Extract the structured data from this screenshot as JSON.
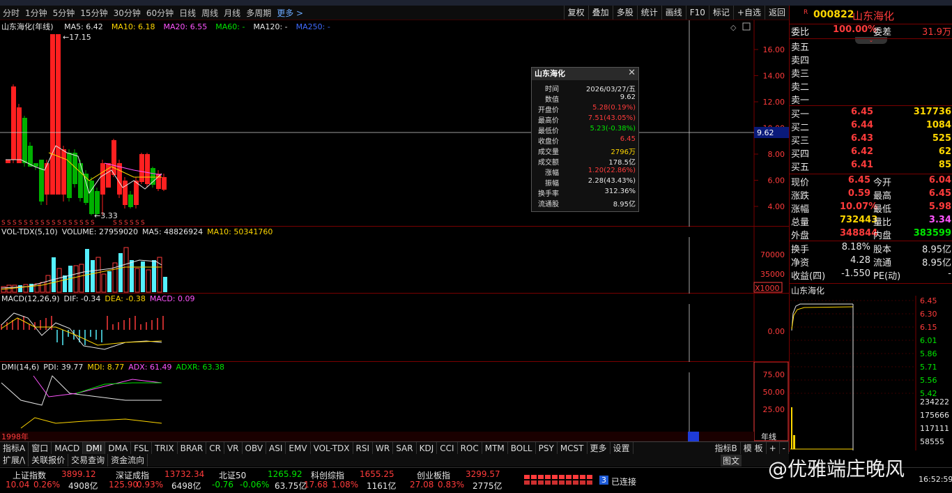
{
  "period_tabs": [
    "分时",
    "1分钟",
    "5分钟",
    "15分钟",
    "30分钟",
    "60分钟",
    "日线",
    "周线",
    "月线",
    "多周期"
  ],
  "period_more": "更多 >",
  "tool_buttons": [
    "复权",
    "叠加",
    "多股",
    "统计",
    "画线",
    "F10",
    "标记",
    "+自选",
    "返回"
  ],
  "main_chart": {
    "name": "山东海化(年线)",
    "ma": [
      {
        "label": "MA5: 6.42",
        "color": "#e8e8e8"
      },
      {
        "label": "MA10: 6.18",
        "color": "#ffd700"
      },
      {
        "label": "MA20: 6.55",
        "color": "#ff55ff"
      },
      {
        "label": "MA60: -",
        "color": "#00e600"
      },
      {
        "label": "MA120: -",
        "color": "#e8e8e8"
      },
      {
        "label": "MA250: -",
        "color": "#3f6bff"
      }
    ],
    "high_label": "17.15",
    "low_label": "3.33",
    "cursor_value": "9.62",
    "y_ticks": [
      "16.00",
      "14.00",
      "12.00",
      "10.00",
      "8.00",
      "6.00",
      "4.00"
    ],
    "start_label": "1998年"
  },
  "tooltip": {
    "title": "山东海化",
    "rows": [
      {
        "k": "时间",
        "v": "2026/03/27/五",
        "c": "#e8e8e8"
      },
      {
        "k": "数值",
        "v": "9.62",
        "c": "#e8e8e8"
      },
      {
        "k": "开盘价",
        "v": "5.28(0.19%)",
        "c": "#ff3b3b"
      },
      {
        "k": "最高价",
        "v": "7.51(43.05%)",
        "c": "#ff3b3b"
      },
      {
        "k": "最低价",
        "v": "5.23(-0.38%)",
        "c": "#00e600"
      },
      {
        "k": "收盘价",
        "v": "6.45",
        "c": "#ff3b3b"
      },
      {
        "k": "成交量",
        "v": "2796万",
        "c": "#ffd700"
      },
      {
        "k": "成交额",
        "v": "178.5亿",
        "c": "#e8e8e8"
      },
      {
        "k": "涨幅",
        "v": "1.20(22.86%)",
        "c": "#ff3b3b"
      },
      {
        "k": "振幅",
        "v": "2.28(43.43%)",
        "c": "#e8e8e8"
      },
      {
        "k": "换手率",
        "v": "312.36%",
        "c": "#e8e8e8"
      },
      {
        "k": "流通股",
        "v": "8.95亿",
        "c": "#e8e8e8"
      }
    ]
  },
  "vol_panel": {
    "header": [
      {
        "t": "VOL-TDX(5,10)",
        "c": "#e8e8e8"
      },
      {
        "t": "VOLUME: 27959020",
        "c": "#e8e8e8"
      },
      {
        "t": "MA5: 48826924",
        "c": "#e8e8e8"
      },
      {
        "t": "MA10: 50341760",
        "c": "#ffd700"
      }
    ],
    "y_ticks": [
      "70000",
      "35000"
    ],
    "unit": "X1000"
  },
  "macd_panel": {
    "header": [
      {
        "t": "MACD(12,26,9)",
        "c": "#e8e8e8"
      },
      {
        "t": "DIF: -0.34",
        "c": "#e8e8e8"
      },
      {
        "t": "DEA: -0.38",
        "c": "#ffd700"
      },
      {
        "t": "MACD: 0.09",
        "c": "#ff55ff"
      }
    ],
    "y_ticks": [
      "0.00"
    ]
  },
  "dmi_panel": {
    "header": [
      {
        "t": "DMI(14,6)",
        "c": "#e8e8e8"
      },
      {
        "t": "PDI: 39.77",
        "c": "#e8e8e8"
      },
      {
        "t": "MDI: 8.77",
        "c": "#ffd700"
      },
      {
        "t": "ADX: 61.49",
        "c": "#ff55ff"
      },
      {
        "t": "ADXR: 63.38",
        "c": "#00e600"
      }
    ],
    "y_ticks": [
      "75.00",
      "50.00",
      "25.00"
    ],
    "period_label": "年线"
  },
  "stock": {
    "badge": "R",
    "code": "000822",
    "name": "山东海化",
    "weibi_label": "委比",
    "weibi": "100.00%",
    "weicha_label": "委差",
    "weicha": "31.9万",
    "sells": [
      "卖五",
      "卖四",
      "卖三",
      "卖二",
      "卖一"
    ],
    "buys": [
      {
        "k": "买一",
        "p": "6.45",
        "v": "317736"
      },
      {
        "k": "买二",
        "p": "6.44",
        "v": "1084"
      },
      {
        "k": "买三",
        "p": "6.43",
        "v": "525"
      },
      {
        "k": "买四",
        "p": "6.42",
        "v": "62"
      },
      {
        "k": "买五",
        "p": "6.41",
        "v": "85"
      }
    ],
    "quote_rows": [
      {
        "k1": "现价",
        "v1": "6.45",
        "c1": "#ff3b3b",
        "k2": "今开",
        "v2": "6.04",
        "c2": "#ff3b3b"
      },
      {
        "k1": "涨跌",
        "v1": "0.59",
        "c1": "#ff3b3b",
        "k2": "最高",
        "v2": "6.45",
        "c2": "#ff3b3b"
      },
      {
        "k1": "涨幅",
        "v1": "10.07%",
        "c1": "#ff3b3b",
        "k2": "最低",
        "v2": "5.98",
        "c2": "#ff3b3b"
      },
      {
        "k1": "总量",
        "v1": "732443",
        "c1": "#ffd700",
        "k2": "量比",
        "v2": "3.34",
        "c2": "#ff55ff"
      },
      {
        "k1": "外盘",
        "v1": "348844",
        "c1": "#ff3b3b",
        "k2": "内盘",
        "v2": "383599",
        "c2": "#00e600"
      }
    ],
    "fin_rows": [
      {
        "k1": "换手",
        "v1": "8.18%",
        "k2": "股本",
        "v2": "8.95亿"
      },
      {
        "k1": "净资",
        "v1": "4.28",
        "k2": "流通",
        "v2": "8.95亿"
      },
      {
        "k1": "收益(四)",
        "v1": "-1.550",
        "k2": "PE(动)",
        "v2": "-"
      }
    ],
    "mini_title": "山东海化",
    "mini_price_ticks": [
      "6.45",
      "6.30",
      "6.15",
      "6.01",
      "5.86",
      "5.71",
      "5.56",
      "5.42"
    ],
    "mini_vol_ticks": [
      "234222",
      "175666",
      "117111",
      "58555"
    ]
  },
  "indicator_tabs": [
    "指标A",
    "窗口",
    "MACD",
    "DMI",
    "DMA",
    "FSL",
    "TRIX",
    "BRAR",
    "CR",
    "VR",
    "OBV",
    "ASI",
    "EMV",
    "VOL-TDX",
    "RSI",
    "WR",
    "SAR",
    "KDJ",
    "CCI",
    "ROC",
    "MTM",
    "BOLL",
    "PSY",
    "MCST",
    "更多",
    "设置"
  ],
  "indicator_right": [
    "指标B",
    "模 板",
    "+",
    "-"
  ],
  "sub_tabs": [
    "扩展/\\",
    "关联报价",
    "交易查询",
    "资金流向"
  ],
  "indices": [
    {
      "name": "上证指数",
      "value": "3899.12",
      "chg": "10.04",
      "pct": "0.26%",
      "amt": "4908亿",
      "color": "#ff3b3b"
    },
    {
      "name": "深证成指",
      "value": "13732.34",
      "chg": "125.90",
      "pct": "0.93%",
      "amt": "6498亿",
      "color": "#ff3b3b"
    },
    {
      "name": "北证50",
      "value": "1265.92",
      "chg": "-0.76",
      "pct": "-0.06%",
      "amt": "63.75亿",
      "color": "#00e600"
    },
    {
      "name": "科创综指",
      "value": "1655.25",
      "chg": "17.68",
      "pct": "1.08%",
      "amt": "1161亿",
      "color": "#ff3b3b"
    },
    {
      "name": "创业板指",
      "value": "3299.57",
      "chg": "27.08",
      "pct": "0.83%",
      "amt": "2775亿",
      "color": "#ff3b3b"
    }
  ],
  "connection": {
    "badge": "3",
    "text": "已连接"
  },
  "watermark": "@优雅端庄晚风",
  "watermark_right": "图文",
  "clock": "16:52:59"
}
